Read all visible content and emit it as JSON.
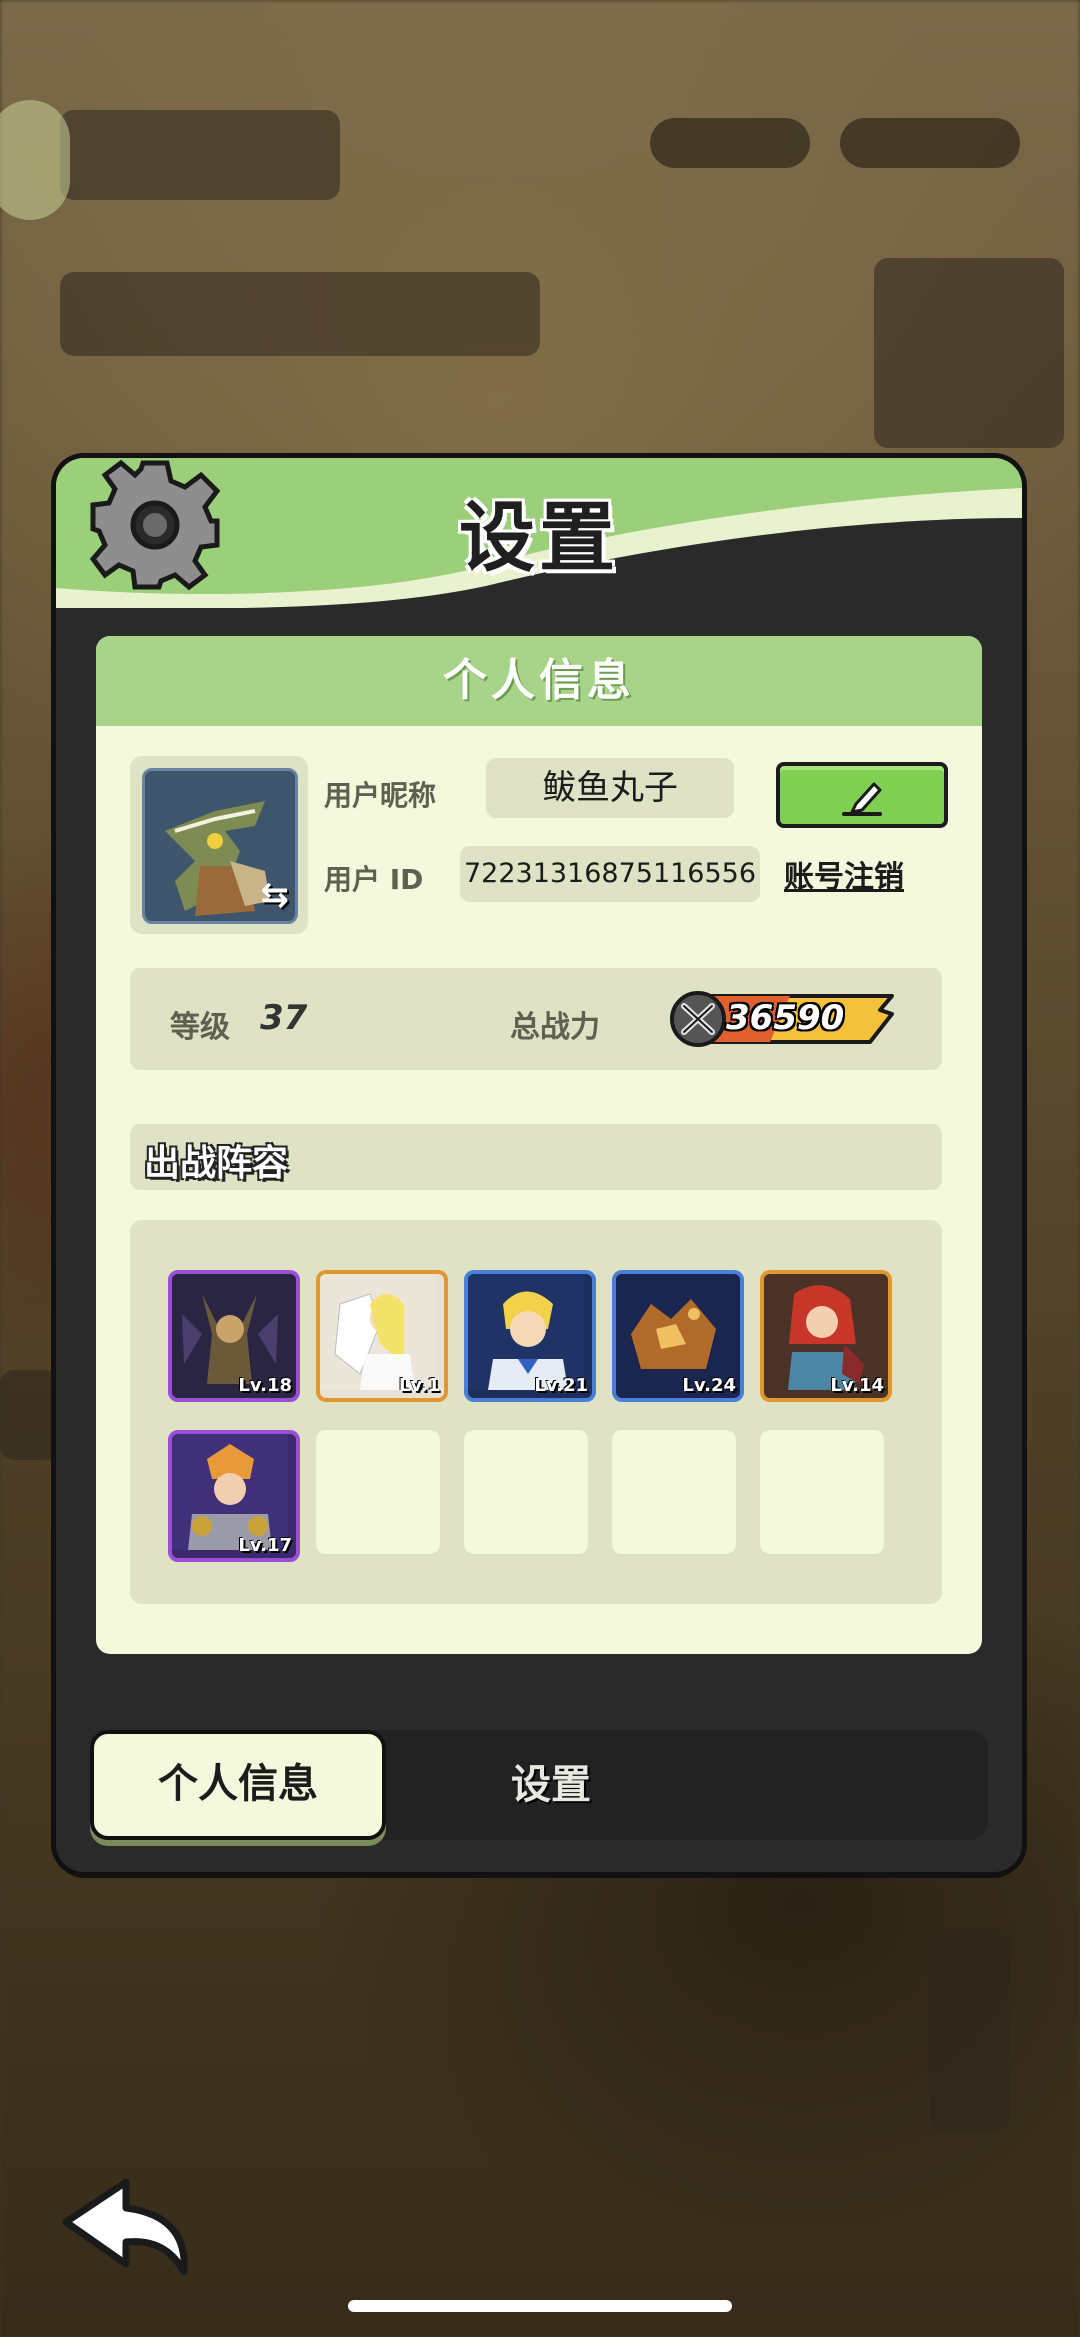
{
  "panel": {
    "title": "设置",
    "section_title": "个人信息"
  },
  "profile": {
    "nickname_label": "用户昵称",
    "nickname": "鲅鱼丸子",
    "id_label": "用户  ID",
    "user_id": "72231316875116556",
    "delete_account": "账号注销"
  },
  "stats": {
    "level_label": "等级",
    "level": "37",
    "power_label": "总战力",
    "power": "36590"
  },
  "lineup": {
    "title": "出战阵容",
    "heroes": [
      {
        "level": "Lv.18",
        "rarity": "purple"
      },
      {
        "level": "Lv.1",
        "rarity": "orange"
      },
      {
        "level": "Lv.21",
        "rarity": "blue"
      },
      {
        "level": "Lv.24",
        "rarity": "blue"
      },
      {
        "level": "Lv.14",
        "rarity": "orange"
      },
      {
        "level": "Lv.17",
        "rarity": "purple"
      }
    ],
    "empty_slots": 4
  },
  "tabs": {
    "personal_info": "个人信息",
    "settings": "设置"
  },
  "colors": {
    "header_green": "#9ccf7a",
    "content_bg": "#f4f8dc",
    "edit_button": "#7fcf52",
    "purple_frame": "#9b4fd6",
    "orange_frame": "#e0972e",
    "blue_frame": "#4a7fd8"
  }
}
